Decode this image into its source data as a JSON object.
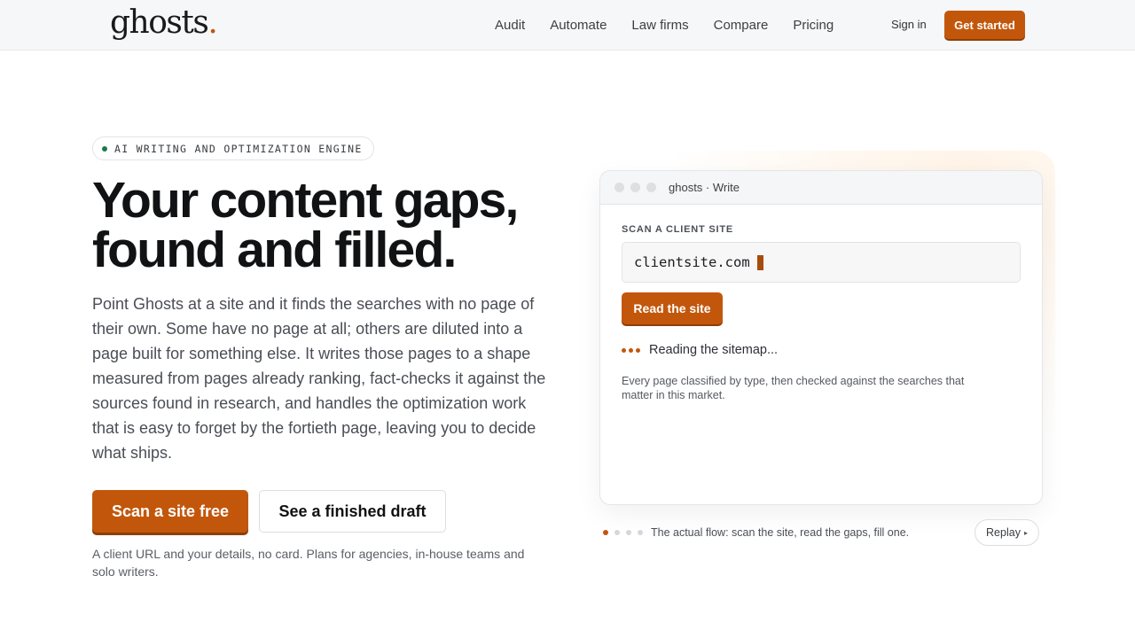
{
  "brand": {
    "name": "ghosts",
    "dot": ".",
    "accent": "#c2570c"
  },
  "nav": {
    "items": [
      "Audit",
      "Automate",
      "Law firms",
      "Compare",
      "Pricing"
    ],
    "sign_in": "Sign in",
    "get_started": "Get started"
  },
  "hero": {
    "badge": "AI WRITING AND OPTIMIZATION ENGINE",
    "headline_line1": "Your content gaps,",
    "headline_line2": "found and filled.",
    "lede": "Point Ghosts at a site and it finds the searches with no page of their own. Some have no page at all; others are diluted into a page built for something else. It writes those pages to a shape measured from pages already ranking, fact-checks it against the sources found in research, and handles the optimization work that is easy to forget by the fortieth page, leaving you to decide what ships.",
    "cta_primary": "Scan a site free",
    "cta_secondary": "See a finished draft",
    "fineprint": "A client URL and your details, no card. Plans for agencies, in-house teams and solo writers."
  },
  "demo": {
    "window_title": "ghosts · Write",
    "scan_label": "SCAN A CLIENT SITE",
    "url_value": "clientsite.com",
    "read_button": "Read the site",
    "status": "Reading the sitemap...",
    "note": "Every page classified by type, then checked against the searches that matter in this market.",
    "flow_caption": "The actual flow: scan the site, read the gaps, fill one.",
    "replay": "Replay",
    "steps_total": 4,
    "step_active": 1
  }
}
